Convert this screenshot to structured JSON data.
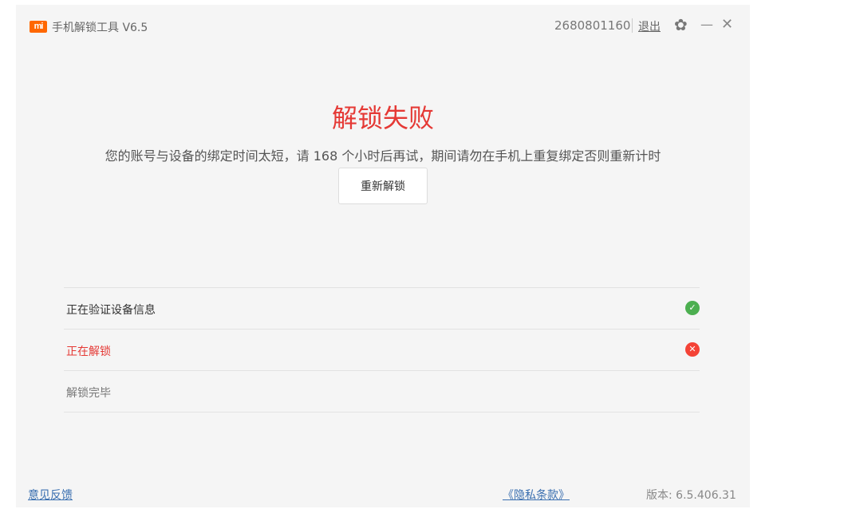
{
  "header": {
    "logo_text": "mi",
    "app_title": "手机解锁工具  V6.5",
    "account_id": "2680801160",
    "logout_label": "退出",
    "settings_icon": "✿",
    "minimize_icon": "—",
    "close_icon": "✕"
  },
  "result": {
    "title": "解锁失败",
    "message": "您的账号与设备的绑定时间太短，请 168 个小时后再试，期间请勿在手机上重复绑定否则重新计时",
    "retry_label": "重新解锁"
  },
  "steps": [
    {
      "label": "正在验证设备信息",
      "status": "success",
      "icon": "✓"
    },
    {
      "label": "正在解锁",
      "status": "error",
      "icon": "✕"
    },
    {
      "label": "解锁完毕",
      "status": "pending",
      "icon": ""
    }
  ],
  "footer": {
    "feedback_label": "意见反馈",
    "privacy_label": "《隐私条款》",
    "version_text": "版本: 6.5.406.31"
  },
  "colors": {
    "brand": "#ff6700",
    "error": "#e53935",
    "success": "#4caf50"
  }
}
